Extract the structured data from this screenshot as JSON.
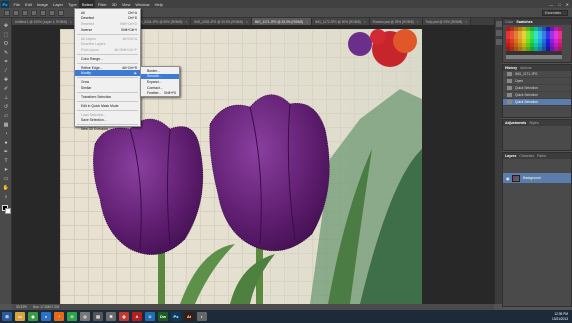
{
  "app": {
    "logo": "Ps",
    "menus": [
      "File",
      "Edit",
      "Image",
      "Layer",
      "Type",
      "Select",
      "Filter",
      "3D",
      "View",
      "Window",
      "Help"
    ],
    "active_menu": "Select",
    "window_buttons": [
      "—",
      "□",
      "✕"
    ]
  },
  "options_bar": {
    "workspace": "Essentials"
  },
  "tabs": [
    {
      "label": "Untitled-1 @ 100% (Layer 1, RGB/8)",
      "active": false
    },
    {
      "label": "IMG_0231.JPG @ 50% (RGB/8)",
      "active": false
    },
    {
      "label": "IMG_0234.JPG @ 50% (RGB/8)",
      "active": false
    },
    {
      "label": "IMG_0235.JPG @ 33.3% (RGB/8)",
      "active": false
    },
    {
      "label": "IMG_1171.JPG @ 33.3% (RGB/8)",
      "active": true
    },
    {
      "label": "IMG_1172.JPG @ 50% (RGB/8)",
      "active": false
    },
    {
      "label": "Flowers.psd @ 25% (RGB/8)",
      "active": false
    },
    {
      "label": "Tulip.psd @ 25% (RGB/8)",
      "active": false
    }
  ],
  "select_menu": {
    "items": [
      {
        "label": "All",
        "shortcut": "Ctrl+A",
        "disabled": false
      },
      {
        "label": "Deselect",
        "shortcut": "Ctrl+D",
        "disabled": false
      },
      {
        "label": "Reselect",
        "shortcut": "Shift+Ctrl+D",
        "disabled": true
      },
      {
        "label": "Inverse",
        "shortcut": "Shift+Ctrl+I",
        "disabled": false
      },
      {
        "sep": true
      },
      {
        "label": "All Layers",
        "shortcut": "Alt+Ctrl+A",
        "disabled": true
      },
      {
        "label": "Deselect Layers",
        "shortcut": "",
        "disabled": true
      },
      {
        "label": "Find Layers",
        "shortcut": "Alt+Shift+Ctrl+F",
        "disabled": true
      },
      {
        "sep": true
      },
      {
        "label": "Color Range...",
        "shortcut": "",
        "disabled": false
      },
      {
        "sep": true
      },
      {
        "label": "Refine Edge...",
        "shortcut": "Alt+Ctrl+R",
        "disabled": false
      },
      {
        "label": "Modify",
        "shortcut": "▶",
        "disabled": false,
        "hover": true
      },
      {
        "sep": true
      },
      {
        "label": "Grow",
        "shortcut": "",
        "disabled": false
      },
      {
        "label": "Similar",
        "shortcut": "",
        "disabled": false
      },
      {
        "sep": true
      },
      {
        "label": "Transform Selection",
        "shortcut": "",
        "disabled": false
      },
      {
        "sep": true
      },
      {
        "label": "Edit in Quick Mask Mode",
        "shortcut": "",
        "disabled": false
      },
      {
        "sep": true
      },
      {
        "label": "Load Selection...",
        "shortcut": "",
        "disabled": true
      },
      {
        "label": "Save Selection...",
        "shortcut": "",
        "disabled": false
      },
      {
        "sep": true
      },
      {
        "label": "New 3D Extrusion",
        "shortcut": "",
        "disabled": false
      }
    ]
  },
  "modify_submenu": {
    "items": [
      {
        "label": "Border...",
        "shortcut": "",
        "hover": false
      },
      {
        "label": "Smooth...",
        "shortcut": "",
        "hover": true
      },
      {
        "label": "Expand...",
        "shortcut": "",
        "hover": false
      },
      {
        "label": "Contract...",
        "shortcut": "",
        "hover": false
      },
      {
        "label": "Feather...",
        "shortcut": "Shift+F6",
        "hover": false
      }
    ]
  },
  "panels": {
    "color_tabs": [
      "Color",
      "Swatches"
    ],
    "history_tabs": [
      "History",
      "Actions"
    ],
    "history": {
      "snapshot": "IMG_1171.JPG",
      "items": [
        "Open",
        "Quick Selection",
        "Quick Selection",
        "Quick Selection"
      ]
    },
    "adjust_tabs": [
      "Adjustments",
      "Styles"
    ],
    "layers_tabs": [
      "Layers",
      "Channels",
      "Paths"
    ],
    "layers": [
      {
        "name": "Background"
      }
    ]
  },
  "status": {
    "zoom": "33.33%",
    "doc": "Doc: 17.2M/17.2M"
  },
  "taskbar": {
    "icons": [
      {
        "name": "windows-start-icon",
        "glyph": "⊞",
        "color": "#2b5aa0"
      },
      {
        "name": "file-explorer-icon",
        "glyph": "▭",
        "color": "#d9a43a"
      },
      {
        "name": "chrome-icon",
        "glyph": "◉",
        "color": "#3c9a43"
      },
      {
        "name": "ie-icon",
        "glyph": "e",
        "color": "#2a72c9"
      },
      {
        "name": "firefox-icon",
        "glyph": "◔",
        "color": "#e56a1b"
      },
      {
        "name": "quickbooks-icon",
        "glyph": "⊙",
        "color": "#2ea44a"
      },
      {
        "name": "app-icon",
        "glyph": "◎",
        "color": "#777"
      },
      {
        "name": "calc-icon",
        "glyph": "▤",
        "color": "#555"
      },
      {
        "name": "settings-icon",
        "glyph": "✱",
        "color": "#6a6a6a"
      },
      {
        "name": "media-icon",
        "glyph": "◍",
        "color": "#c0392b"
      },
      {
        "name": "acrobat-icon",
        "glyph": "A",
        "color": "#b41e1e"
      },
      {
        "name": "vpn-icon",
        "glyph": "U",
        "color": "#1f6fb5"
      },
      {
        "name": "dreamweaver-icon",
        "glyph": "Dw",
        "color": "#1b5e20"
      },
      {
        "name": "photoshop-icon",
        "glyph": "Ps",
        "color": "#0b3b5b"
      },
      {
        "name": "illustrator-icon",
        "glyph": "Ai",
        "color": "#3a1e0e"
      },
      {
        "name": "app2-icon",
        "glyph": "◐",
        "color": "#666"
      }
    ],
    "time": "12:39 PM",
    "date": "10/21/2013"
  },
  "colors": {
    "tulip": "#5e1d6e",
    "leaf": "#4b7c43",
    "highlight": "#3d7ad6"
  }
}
